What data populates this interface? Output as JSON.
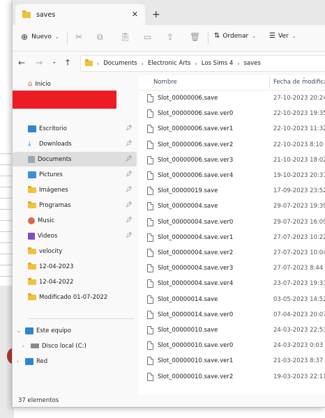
{
  "window": {
    "tab_title": "saves",
    "new_tab_symbol": "+"
  },
  "toolbar": {
    "new_label": "Nuevo",
    "sort_label": "Ordenar",
    "view_label": "Ver"
  },
  "address": {
    "crumbs": [
      "Documents",
      "Electronic Arts",
      "Los Sims 4",
      "saves"
    ]
  },
  "nav": {
    "home": "Inicio",
    "quick": [
      {
        "label": "Escritorio",
        "icon": "desktop-icon",
        "pinned": true
      },
      {
        "label": "Downloads",
        "icon": "download-icon",
        "pinned": true
      },
      {
        "label": "Documents",
        "icon": "documents-icon",
        "pinned": true,
        "selected": true
      },
      {
        "label": "Pictures",
        "icon": "pictures-icon",
        "pinned": true
      },
      {
        "label": "Imágenes",
        "icon": "folder-icon",
        "pinned": true
      },
      {
        "label": "Programas",
        "icon": "folder-icon",
        "pinned": true
      },
      {
        "label": "Music",
        "icon": "music-icon",
        "pinned": true
      },
      {
        "label": "Videos",
        "icon": "videos-icon",
        "pinned": true
      },
      {
        "label": "velocity",
        "icon": "folder-icon",
        "pinned": false
      },
      {
        "label": "12-04-2023",
        "icon": "folder-icon",
        "pinned": false
      },
      {
        "label": "12-04-2022",
        "icon": "folder-icon",
        "pinned": false
      },
      {
        "label": "Modificado 01-07-2022",
        "icon": "folder-icon",
        "pinned": false
      }
    ],
    "this_pc": "Este equipo",
    "local_disk": "Disco local (C:)",
    "network": "Red"
  },
  "columns": {
    "name": "Nombre",
    "date": "Fecha de modificación"
  },
  "files": [
    {
      "name": "Slot_00000006.save",
      "date": "27-10-2023 20:24"
    },
    {
      "name": "Slot_00000006.save.ver0",
      "date": "22-10-2023 19:35"
    },
    {
      "name": "Slot_00000006.save.ver1",
      "date": "22-10-2023 11:32"
    },
    {
      "name": "Slot_00000006.save.ver2",
      "date": "22-10-2023 8:10"
    },
    {
      "name": "Slot_00000006.save.ver3",
      "date": "21-10-2023 18:02"
    },
    {
      "name": "Slot_00000006.save.ver4",
      "date": "19-10-2023 20:37"
    },
    {
      "name": "Slot_00000019.save",
      "date": "17-09-2023 23:52"
    },
    {
      "name": "Slot_00000004.save",
      "date": "29-07-2023 19:39"
    },
    {
      "name": "Slot_00000004.save.ver0",
      "date": "29-07-2023 16:09"
    },
    {
      "name": "Slot_00000004.save.ver1",
      "date": "27-07-2023 10:22"
    },
    {
      "name": "Slot_00000004.save.ver2",
      "date": "27-07-2023 10:04"
    },
    {
      "name": "Slot_00000004.save.ver3",
      "date": "27-07-2023 8:44"
    },
    {
      "name": "Slot_00000004.save.ver4",
      "date": "23-07-2023 19:33"
    },
    {
      "name": "Slot_00000014.save",
      "date": "03-05-2023 14:52"
    },
    {
      "name": "Slot_00000014.save.ver0",
      "date": "07-04-2023 20:07"
    },
    {
      "name": "Slot_00000010.save",
      "date": "24-03-2023 22:53"
    },
    {
      "name": "Slot_00000010.save.ver0",
      "date": "24-03-2023 0:03"
    },
    {
      "name": "Slot_00000010.save.ver1",
      "date": "21-03-2023 8:37"
    },
    {
      "name": "Slot_00000010.save.ver2",
      "date": "19-03-2023 22:11"
    }
  ],
  "status": {
    "count": "37 elementos"
  },
  "colors": {
    "folder": "#f3c23c",
    "redaction": "#ed1c24",
    "selected": "#dedede"
  }
}
